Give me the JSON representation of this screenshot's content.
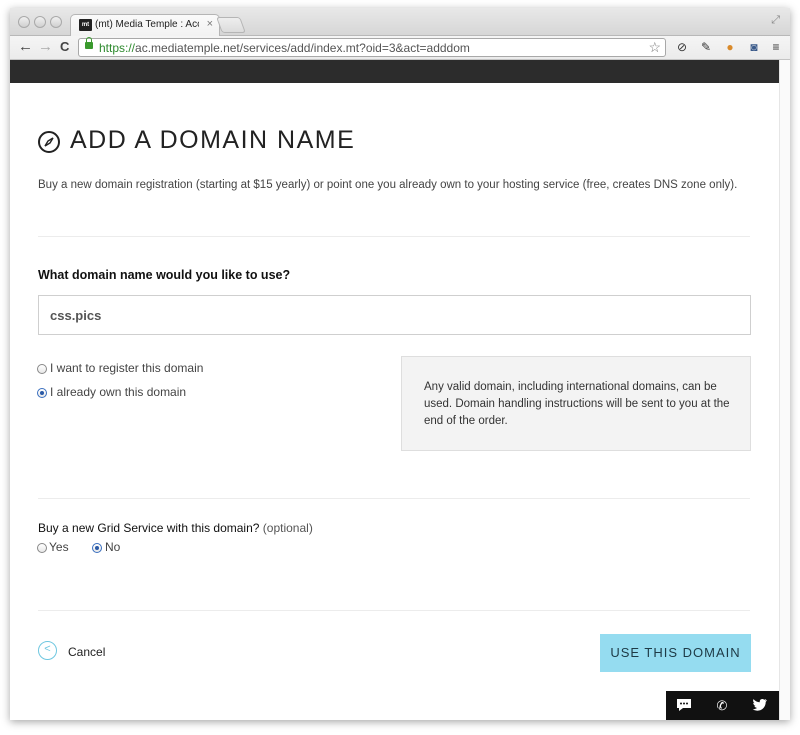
{
  "browser": {
    "tab_title": "(mt) Media Temple : Accou",
    "favicon_text": "mt",
    "url_scheme": "https://",
    "url_rest": "ac.mediatemple.net/services/add/index.mt?oid=3&act=adddom",
    "nav_back": "←",
    "nav_forward": "→",
    "nav_reload": "C"
  },
  "page": {
    "title": "ADD A DOMAIN NAME",
    "intro": "Buy a new domain registration (starting at $15 yearly) or point one you already own to your hosting service (free, creates DNS zone only).",
    "question": "What domain name would you like to use?",
    "domain_value": "css.pics",
    "options": {
      "register_label": "I want to register this domain",
      "own_label": "I already own this domain",
      "selected": "own"
    },
    "info_text": "Any valid domain, including international domains, can be used. Domain handling instructions will be sent to you at the end of the order.",
    "grid_question": "Buy a new Grid Service with this domain?",
    "grid_optional": "(optional)",
    "grid_yes": "Yes",
    "grid_no": "No",
    "grid_selected": "No",
    "cancel_label": "Cancel",
    "submit_label": "USE THIS DOMAIN"
  },
  "colors": {
    "accent": "#95dcf0",
    "cancel_icon": "#6fc7e0",
    "dark_bar": "#2c2c2c"
  }
}
